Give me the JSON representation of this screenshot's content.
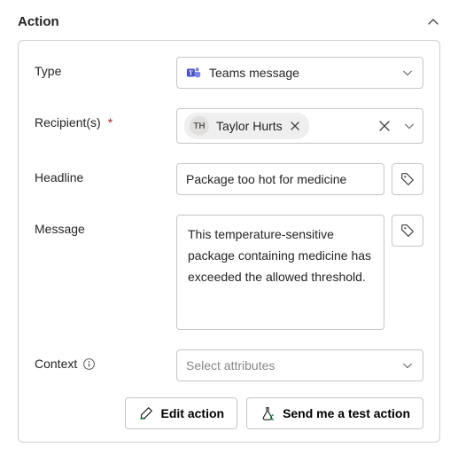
{
  "section": {
    "title": "Action"
  },
  "fields": {
    "type": {
      "label": "Type",
      "value": "Teams message"
    },
    "recipients": {
      "label": "Recipient(s)",
      "required": true,
      "chips": [
        {
          "initials": "TH",
          "name": "Taylor Hurts"
        }
      ]
    },
    "headline": {
      "label": "Headline",
      "value": "Package too hot for medicine"
    },
    "message": {
      "label": "Message",
      "value": "This temperature-sensitive package containing medicine has exceeded the allowed threshold."
    },
    "context": {
      "label": "Context",
      "placeholder": "Select attributes"
    }
  },
  "buttons": {
    "edit": "Edit action",
    "test": "Send me a test action"
  }
}
